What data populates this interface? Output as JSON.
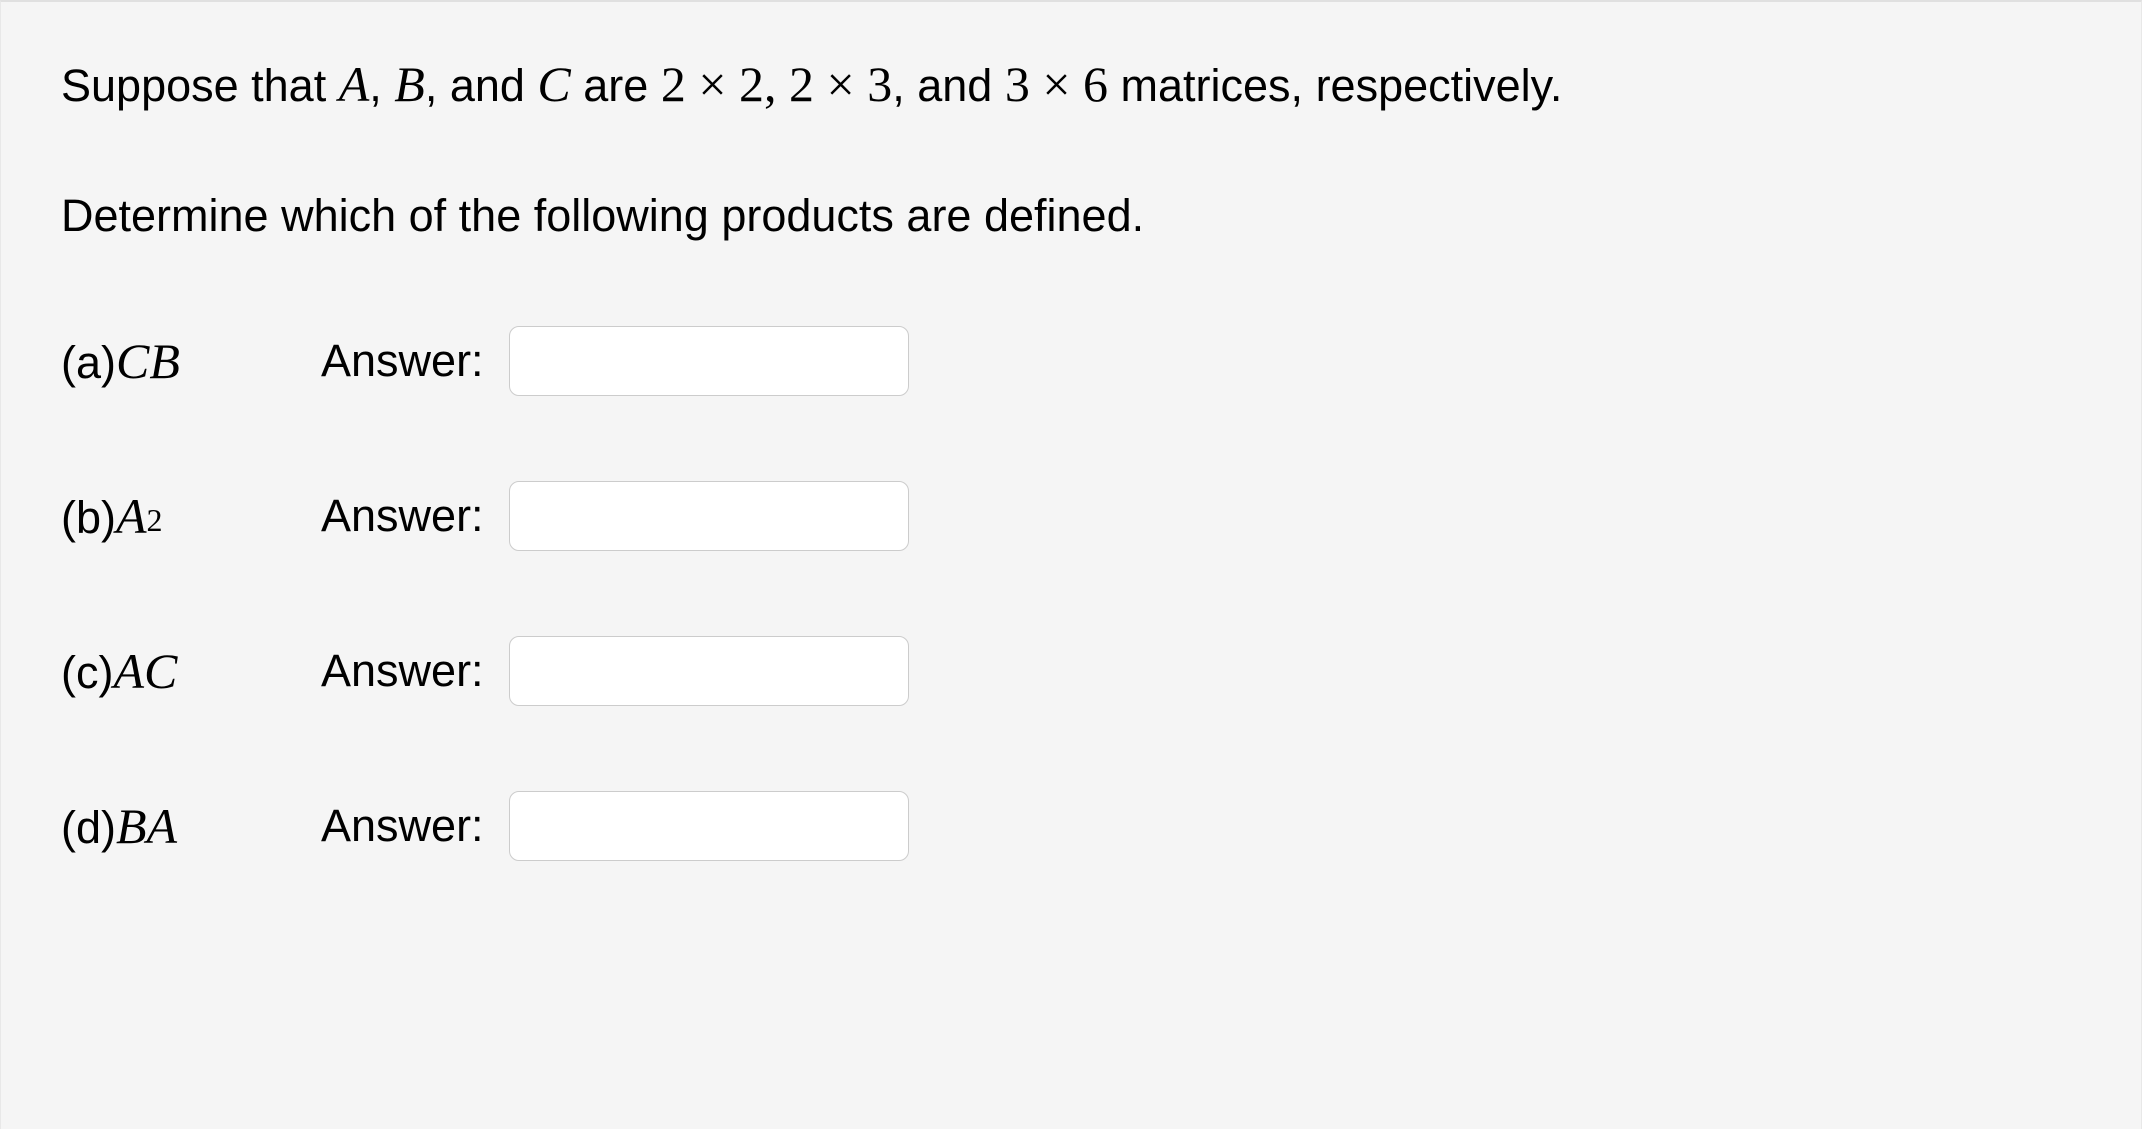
{
  "intro": {
    "prefix": "Suppose that ",
    "A": "A",
    "comma1": ", ",
    "B": "B",
    "comma2": ", and ",
    "C": "C",
    "mid": " are ",
    "dim1_a": "2",
    "times": " × ",
    "dim1_b": "2",
    "sep1": ", ",
    "dim2_a": "2",
    "dim2_b": "3",
    "sep2": ", and ",
    "dim3_a": "3",
    "dim3_b": "6",
    "suffix": " matrices, respectively."
  },
  "instruction": "Determine which of the following products are defined.",
  "answer_label": "Answer:",
  "parts": {
    "a": {
      "paren_open": "(a) ",
      "expr_1": "C",
      "expr_2": "B",
      "value": ""
    },
    "b": {
      "paren_open": "(b) ",
      "expr_1": "A",
      "sup": "2",
      "value": ""
    },
    "c": {
      "paren_open": "(c) ",
      "expr_1": "A",
      "expr_2": "C",
      "value": ""
    },
    "d": {
      "paren_open": "(d) ",
      "expr_1": "B",
      "expr_2": "A",
      "value": ""
    }
  }
}
